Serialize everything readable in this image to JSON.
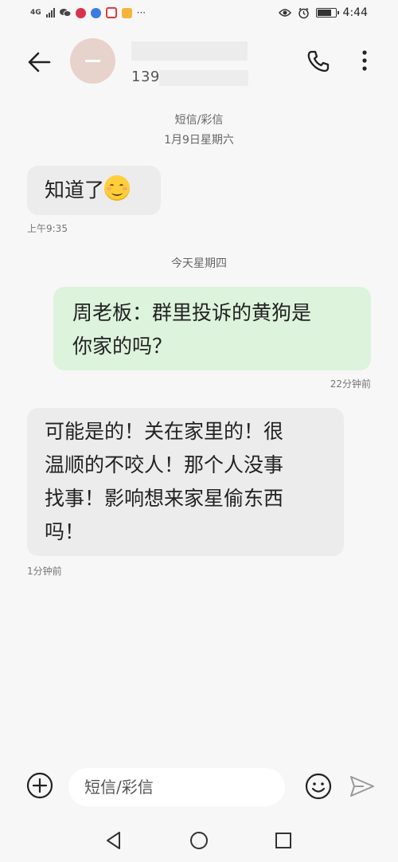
{
  "status_bar": {
    "network": "4G",
    "time": "4:44",
    "battery_level": 0.85,
    "icons": [
      "signal-icon",
      "wechat-icon",
      "app-icon",
      "browser-icon",
      "app-icon",
      "app-icon",
      "more-notifications-icon",
      "eye-comfort-icon",
      "alarm-icon",
      "battery-icon"
    ],
    "more": "···"
  },
  "header": {
    "contact_number_prefix": "139",
    "icons": {
      "back": "arrow-left-icon",
      "call": "phone-icon",
      "more": "more-vertical-icon"
    }
  },
  "thread": {
    "message_type": "短信/彩信",
    "date_first": "1月9日星期六",
    "date_today": "今天星期四",
    "messages": [
      {
        "direction": "incoming",
        "text": "知道了",
        "emoji": "smiling-face-icon",
        "time": "上午9:35"
      },
      {
        "direction": "outgoing",
        "lines": [
          "周老板：群里投诉的黄狗是",
          "你家的吗？"
        ],
        "time": "22分钟前"
      },
      {
        "direction": "incoming",
        "lines": [
          "可能是的！关在家里的！很",
          "温顺的不咬人！那个人没事",
          "找事！影响想来家星偷东西",
          "吗！"
        ],
        "time": "1分钟前"
      }
    ]
  },
  "compose": {
    "placeholder": "短信/彩信",
    "icons": {
      "add": "add-circle-icon",
      "emoji": "emoji-icon",
      "send": "send-icon"
    }
  },
  "nav_bar": {
    "icons": {
      "back": "triangle-back-icon",
      "home": "circle-home-icon",
      "recent": "square-recent-icon"
    }
  },
  "colors": {
    "background": "#f7f7f7",
    "incoming_bubble": "#ececec",
    "outgoing_bubble": "#ddf3dc",
    "avatar": "#e8d2cc"
  }
}
